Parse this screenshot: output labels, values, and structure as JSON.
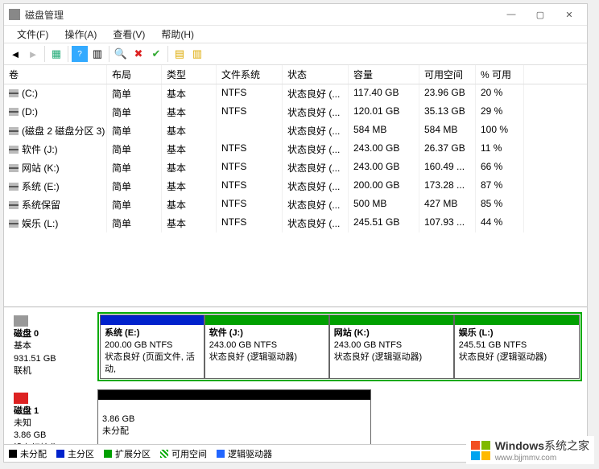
{
  "title": "磁盘管理",
  "menu": [
    "文件(F)",
    "操作(A)",
    "查看(V)",
    "帮助(H)"
  ],
  "columns": [
    "卷",
    "布局",
    "类型",
    "文件系统",
    "状态",
    "容量",
    "可用空间",
    "% 可用"
  ],
  "volumes": [
    {
      "name": "(C:)",
      "layout": "简单",
      "type": "基本",
      "fs": "NTFS",
      "status": "状态良好 (...",
      "cap": "117.40 GB",
      "free": "23.96 GB",
      "pct": "20 %"
    },
    {
      "name": "(D:)",
      "layout": "简单",
      "type": "基本",
      "fs": "NTFS",
      "status": "状态良好 (...",
      "cap": "120.01 GB",
      "free": "35.13 GB",
      "pct": "29 %"
    },
    {
      "name": "(磁盘 2 磁盘分区 3)",
      "layout": "简单",
      "type": "基本",
      "fs": "",
      "status": "状态良好 (...",
      "cap": "584 MB",
      "free": "584 MB",
      "pct": "100 %"
    },
    {
      "name": "软件 (J:)",
      "layout": "简单",
      "type": "基本",
      "fs": "NTFS",
      "status": "状态良好 (...",
      "cap": "243.00 GB",
      "free": "26.37 GB",
      "pct": "11 %"
    },
    {
      "name": "网站 (K:)",
      "layout": "简单",
      "type": "基本",
      "fs": "NTFS",
      "status": "状态良好 (...",
      "cap": "243.00 GB",
      "free": "160.49 ...",
      "pct": "66 %"
    },
    {
      "name": "系统 (E:)",
      "layout": "简单",
      "type": "基本",
      "fs": "NTFS",
      "status": "状态良好 (...",
      "cap": "200.00 GB",
      "free": "173.28 ...",
      "pct": "87 %"
    },
    {
      "name": "系统保留",
      "layout": "简单",
      "type": "基本",
      "fs": "NTFS",
      "status": "状态良好 (...",
      "cap": "500 MB",
      "free": "427 MB",
      "pct": "85 %"
    },
    {
      "name": "娱乐 (L:)",
      "layout": "简单",
      "type": "基本",
      "fs": "NTFS",
      "status": "状态良好 (...",
      "cap": "245.51 GB",
      "free": "107.93 ...",
      "pct": "44 %"
    }
  ],
  "disks": [
    {
      "name": "磁盘 0",
      "kind": "基本",
      "size": "931.51 GB",
      "state": "联机",
      "highlight": true,
      "parts": [
        {
          "label": "系统  (E:)",
          "sz": "200.00 GB NTFS",
          "st": "状态良好 (页面文件, 活动,",
          "stripe": "blue",
          "flex": 200
        },
        {
          "label": "软件  (J:)",
          "sz": "243.00 GB NTFS",
          "st": "状态良好 (逻辑驱动器)",
          "stripe": "green",
          "flex": 243
        },
        {
          "label": "网站  (K:)",
          "sz": "243.00 GB NTFS",
          "st": "状态良好 (逻辑驱动器)",
          "stripe": "green",
          "flex": 243
        },
        {
          "label": "娱乐  (L:)",
          "sz": "245.51 GB NTFS",
          "st": "状态良好 (逻辑驱动器)",
          "stripe": "green",
          "flex": 245
        }
      ]
    },
    {
      "name": "磁盘 1",
      "kind": "未知",
      "size": "3.86 GB",
      "state": "没有初始化",
      "icon": "warn",
      "highlight": false,
      "parts": [
        {
          "label": "",
          "sz": "3.86 GB",
          "st": "未分配",
          "stripe": "black",
          "flex": 1
        }
      ]
    }
  ],
  "legend": [
    {
      "sw": "black",
      "t": "未分配"
    },
    {
      "sw": "blue",
      "t": "主分区"
    },
    {
      "sw": "green",
      "t": "扩展分区"
    },
    {
      "sw": "hatch",
      "t": "可用空间"
    },
    {
      "sw": "lblue",
      "t": "逻辑驱动器"
    }
  ],
  "watermark": {
    "brand": "Windows",
    "site": "系统之家",
    "url": "www.bjjmmv.com"
  }
}
